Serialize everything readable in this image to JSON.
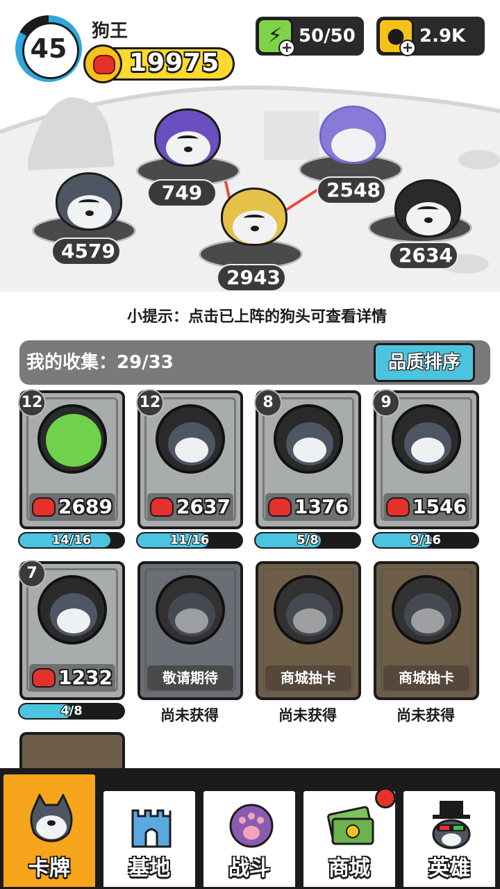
{
  "player": {
    "level": "45",
    "name": "狗王",
    "power": "19975"
  },
  "resources": {
    "energy": "50/50",
    "coins": "2.9K"
  },
  "colors": {
    "accent_blue": "#4cc4e0",
    "power_yellow": "#ffd92e",
    "active_tab": "#f7a51c",
    "glove_red": "#e4312b"
  },
  "lineup": [
    {
      "power": "749"
    },
    {
      "power": "2548"
    },
    {
      "power": "4579"
    },
    {
      "power": "2943"
    },
    {
      "power": "2634"
    }
  ],
  "tip": "小提示：点击已上阵的狗头可查看详情",
  "collection": {
    "label": "我的收集：29/33",
    "sort_button": "品质排序"
  },
  "cards": [
    {
      "level": "12",
      "power": "2689",
      "progress": "14/16",
      "progress_fraction": 0.875
    },
    {
      "level": "12",
      "power": "2637",
      "progress": "11/16",
      "progress_fraction": 0.6875
    },
    {
      "level": "8",
      "power": "1376",
      "progress": "5/8",
      "progress_fraction": 0.625
    },
    {
      "level": "9",
      "power": "1546",
      "progress": "9/16",
      "progress_fraction": 0.5625
    },
    {
      "level": "7",
      "power": "1232",
      "progress": "4/8",
      "progress_fraction": 0.5
    }
  ],
  "locked_cards": [
    {
      "label": "敬请期待",
      "status": "尚未获得"
    },
    {
      "label": "商城抽卡",
      "status": "尚未获得"
    },
    {
      "label": "商城抽卡",
      "status": "尚未获得"
    }
  ],
  "nav": [
    {
      "label": "卡牌",
      "icon": "dog-head-icon",
      "active": true
    },
    {
      "label": "基地",
      "icon": "castle-icon"
    },
    {
      "label": "战斗",
      "icon": "paw-icon"
    },
    {
      "label": "商城",
      "icon": "cash-icon",
      "badge": true
    },
    {
      "label": "英雄",
      "icon": "top-hat-dog-icon"
    }
  ]
}
